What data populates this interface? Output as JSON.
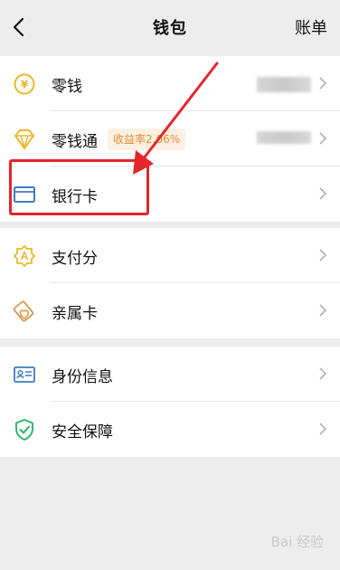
{
  "nav": {
    "title": "钱包",
    "bill_label": "账单"
  },
  "section1": [
    {
      "label": "零钱",
      "icon": "yuan-coin-icon"
    },
    {
      "label": "零钱通",
      "icon": "diamond-icon",
      "badge": "收益率2.06%"
    },
    {
      "label": "银行卡",
      "icon": "bank-card-icon"
    }
  ],
  "section2": [
    {
      "label": "支付分",
      "icon": "pay-score-icon"
    },
    {
      "label": "亲属卡",
      "icon": "family-card-icon"
    }
  ],
  "section3": [
    {
      "label": "身份信息",
      "icon": "id-card-icon"
    },
    {
      "label": "安全保障",
      "icon": "shield-check-icon"
    }
  ],
  "watermark": "Bai 经验",
  "colors": {
    "icon_gold": "#e7b92c",
    "icon_blue": "#3d7bc5",
    "icon_green": "#2bb46a",
    "annotation_red": "#e4262c",
    "badge_orange": "#e48a34"
  }
}
